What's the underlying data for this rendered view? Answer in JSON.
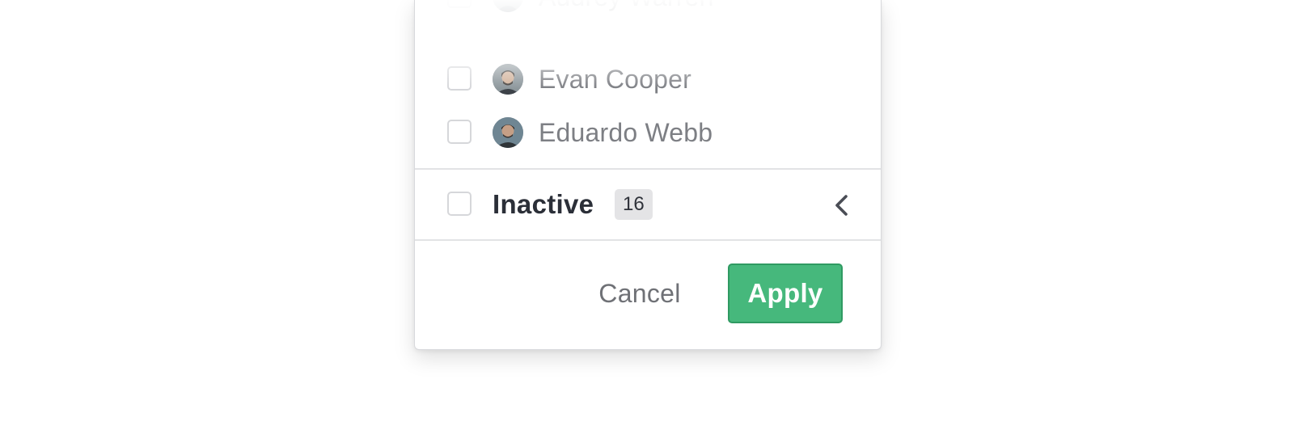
{
  "people": [
    {
      "name": "Audrey Warren",
      "avatar": "person-avatar"
    },
    {
      "name": "Evan Cooper",
      "avatar": "person-avatar"
    },
    {
      "name": "Eduardo Webb",
      "avatar": "person-avatar"
    }
  ],
  "group": {
    "label": "Inactive",
    "count": "16",
    "expand_icon": "chevron-left-icon"
  },
  "footer": {
    "cancel_label": "Cancel",
    "apply_label": "Apply"
  },
  "colors": {
    "apply_bg": "#46b87c",
    "apply_border": "#2f9a62",
    "text_dark": "#2b2f38",
    "text_muted": "#7d7f84"
  }
}
